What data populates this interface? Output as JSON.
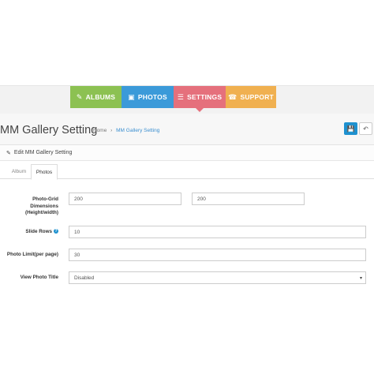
{
  "topnav": {
    "albums": {
      "icon": "✎",
      "label": "ALBUMS"
    },
    "photos": {
      "icon": "▣",
      "label": "PHOTOS"
    },
    "settings": {
      "icon": "☰",
      "label": "SETTINGS"
    },
    "support": {
      "icon": "☎",
      "label": "SUPPORT"
    }
  },
  "header": {
    "title": "MM Gallery Setting",
    "breadcrumb": [
      {
        "label": "Home"
      },
      {
        "sep": "›"
      },
      {
        "label": "MM Gallery Setting"
      }
    ],
    "save_icon": "💾",
    "back_icon": "↶"
  },
  "panel": {
    "icon": "✎",
    "title": "Edit MM Gallery Setting"
  },
  "tabs": {
    "album": "Album",
    "photos": "Photos"
  },
  "form": {
    "grid_label": "Photo-Grid Dimensions (Height/width)",
    "grid_height": "200",
    "grid_width": "200",
    "slide_rows_label": "Slide Rows",
    "slide_rows": "10",
    "photo_limit_label": "Photo Limit(per page)",
    "photo_limit": "30",
    "view_title_label": "View Photo Title",
    "view_title": "Disabled",
    "caret": "▾",
    "help": "?"
  },
  "colors": {
    "albums": "#8cc152",
    "photos": "#3b9ad9",
    "settings": "#e5707c",
    "support": "#f0b050",
    "primary": "#1e91cf"
  }
}
